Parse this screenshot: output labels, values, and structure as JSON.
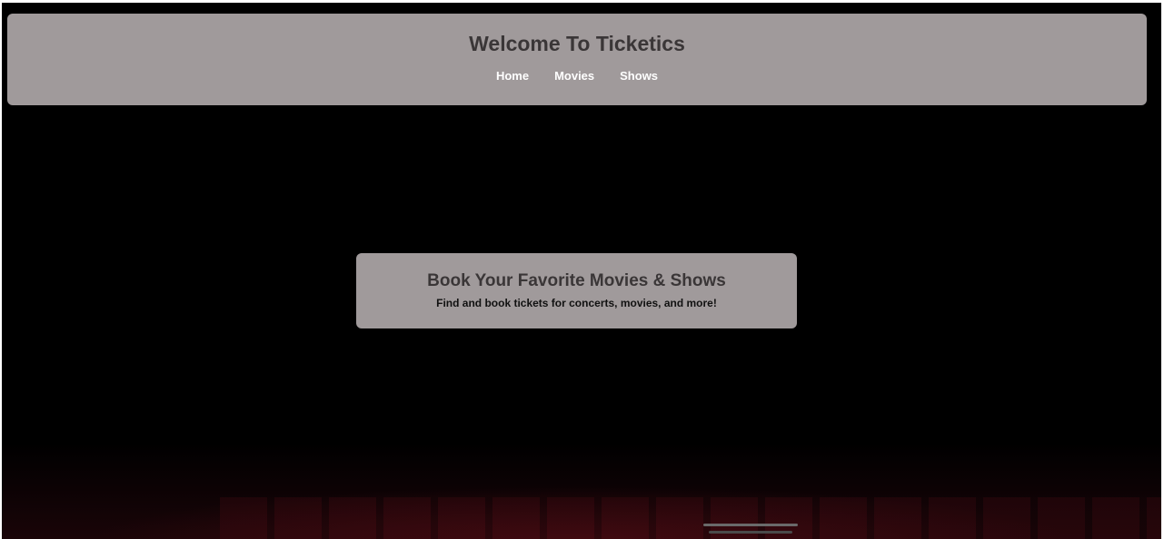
{
  "header": {
    "title": "Welcome To Ticketics",
    "nav": [
      {
        "label": "Home"
      },
      {
        "label": "Movies"
      },
      {
        "label": "Shows"
      }
    ]
  },
  "hero": {
    "title": "Book Your Favorite Movies & Shows",
    "subtitle": "Find and book tickets for concerts, movies, and more!"
  },
  "colors": {
    "panel_background": "#a09a9b",
    "page_background": "#000000",
    "title_text": "#3a3637",
    "nav_text": "#ffffff"
  }
}
